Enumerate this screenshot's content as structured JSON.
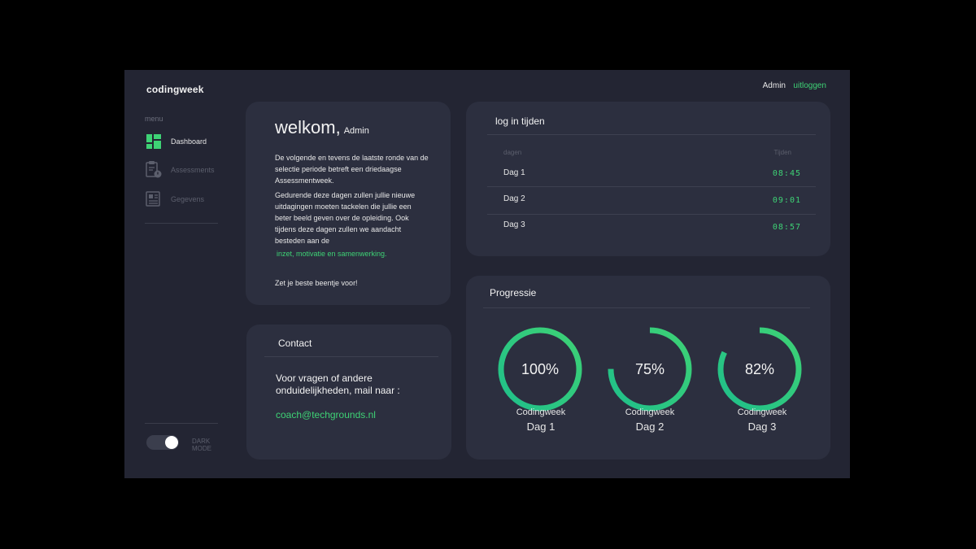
{
  "brand": "codingweek",
  "sidebar": {
    "menu_label": "menu",
    "items": [
      {
        "label": "Dashboard",
        "icon": "dashboard-icon",
        "active": true
      },
      {
        "label": "Assessments",
        "icon": "clipboard-icon",
        "active": false
      },
      {
        "label": "Gegevens",
        "icon": "document-icon",
        "active": false
      }
    ],
    "toggle_label": "DARK MODE",
    "dark_mode": true
  },
  "header": {
    "user": "Admin",
    "logout": "uitloggen"
  },
  "welcome": {
    "title": "welkom,",
    "user": "Admin",
    "p1": "De volgende en tevens de laatste ronde van de selectie periode betreft een driedaagse Assessmentweek.",
    "p2": "Gedurende deze dagen zullen jullie nieuwe uitdagingen moeten tackelen die jullie een beter beeld geven over de opleiding. Ook tijdens deze dagen zullen we aandacht besteden aan de",
    "highlight": "inzet, motivatie en samenwerking.",
    "closing": "Zet je beste beentje voor!"
  },
  "contact": {
    "title": "Contact",
    "text": "Voor vragen of andere onduidelijkheden, mail naar :",
    "email": "coach@techgrounds.nl"
  },
  "login": {
    "title": "log in tijden",
    "col_days": "dagen",
    "col_times": "Tijden",
    "rows": [
      {
        "day": "Dag 1",
        "time": "08:45"
      },
      {
        "day": "Dag 2",
        "time": "09:01"
      },
      {
        "day": "Dag 3",
        "time": "08:57"
      }
    ]
  },
  "progress": {
    "title": "Progressie",
    "items": [
      {
        "value": 100,
        "label": "100%",
        "line1": "Codingweek",
        "line2": "Dag 1"
      },
      {
        "value": 75,
        "label": "75%",
        "line1": "Codingweek",
        "line2": "Dag 2"
      },
      {
        "value": 82,
        "label": "82%",
        "line1": "Codingweek",
        "line2": "Dag 3"
      }
    ]
  },
  "colors": {
    "accent": "#3ed275",
    "accent_dark": "#1fbf8a",
    "panel": "#2c2f3f",
    "background": "#232533"
  }
}
